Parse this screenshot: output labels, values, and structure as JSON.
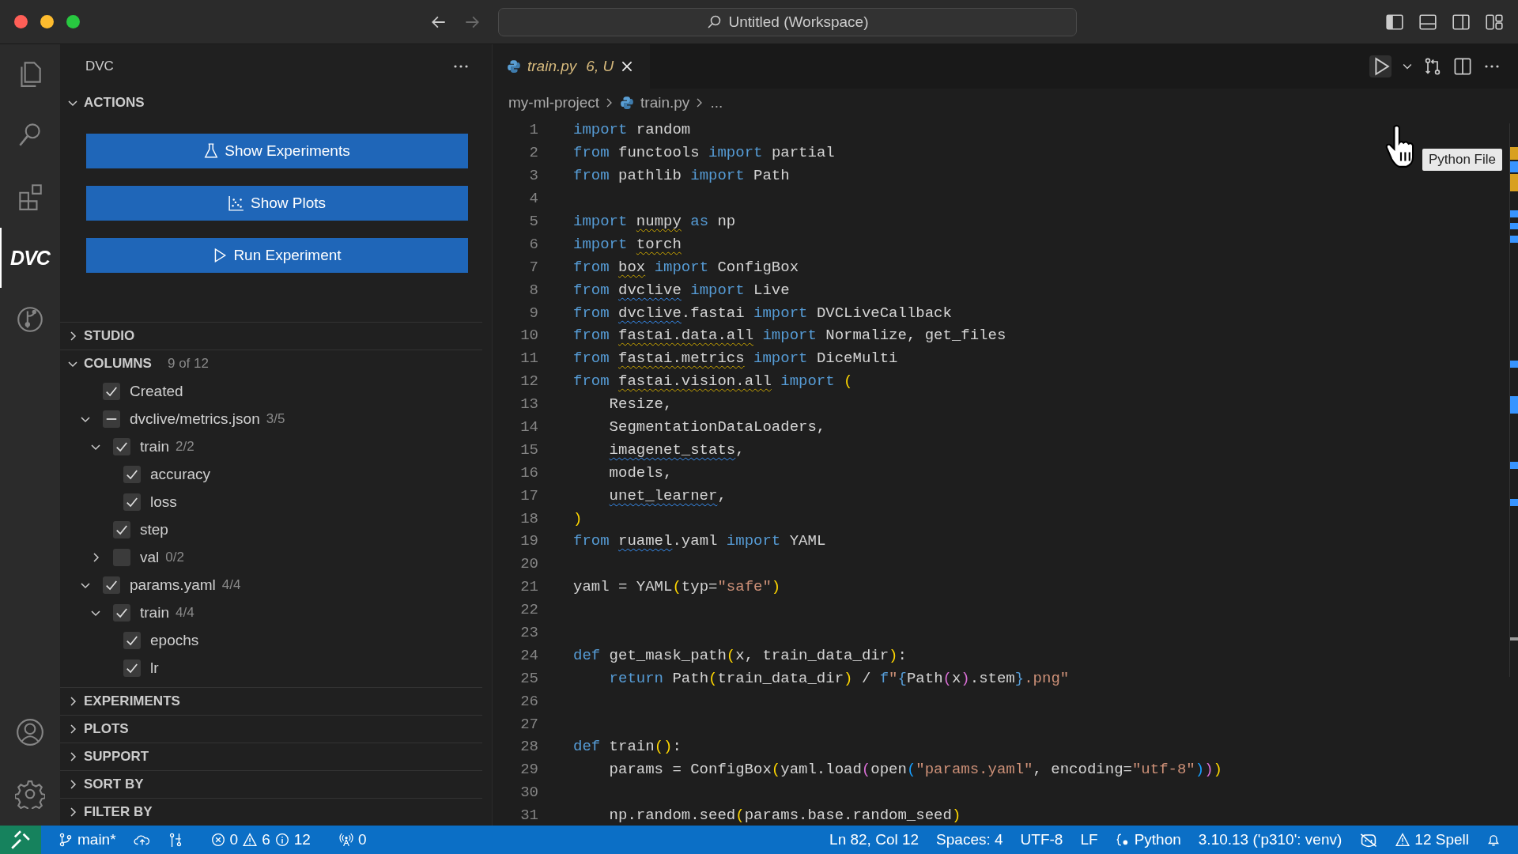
{
  "window": {
    "title": "Untitled (Workspace)",
    "nav": [
      {
        "kind": "back",
        "disabled": false
      },
      {
        "kind": "forward",
        "disabled": true
      }
    ]
  },
  "activity_bar": {
    "items": [
      {
        "kind": "files",
        "selected": false
      },
      {
        "kind": "search",
        "selected": false
      },
      {
        "kind": "extensions",
        "selected": false
      },
      {
        "kind": "dvc",
        "label": "DVC",
        "selected": true
      },
      {
        "kind": "graph",
        "selected": false
      }
    ],
    "bottom": [
      {
        "kind": "account"
      },
      {
        "kind": "settings"
      }
    ]
  },
  "sidebar": {
    "title": "DVC",
    "sections": [
      {
        "kind": "actions",
        "title": "ACTIONS",
        "expanded": true,
        "buttons": [
          {
            "kind": "flask",
            "label": "Show Experiments"
          },
          {
            "kind": "plot",
            "label": "Show Plots"
          },
          {
            "kind": "play",
            "label": "Run Experiment"
          }
        ]
      },
      {
        "kind": "plain",
        "title": "STUDIO",
        "expanded": false
      },
      {
        "kind": "tree",
        "title": "COLUMNS",
        "count": "9 of 12",
        "expanded": true,
        "items": [
          {
            "label": "Created",
            "checked": true
          },
          {
            "label": "dvclive/metrics.json",
            "count": "3/5",
            "mixed": true,
            "expanded": true,
            "children": [
              {
                "label": "train",
                "count": "2/2",
                "checked": true,
                "expanded": true,
                "children": [
                  {
                    "label": "accuracy",
                    "checked": true
                  },
                  {
                    "label": "loss",
                    "checked": true
                  }
                ]
              },
              {
                "label": "step",
                "checked": true
              },
              {
                "label": "val",
                "count": "0/2",
                "checked": false,
                "expanded": false
              }
            ]
          },
          {
            "label": "params.yaml",
            "count": "4/4",
            "checked": true,
            "expanded": true,
            "children": [
              {
                "label": "train",
                "count": "4/4",
                "checked": true,
                "expanded": true,
                "children": [
                  {
                    "label": "epochs",
                    "checked": true
                  },
                  {
                    "label": "lr",
                    "checked": true
                  }
                ]
              }
            ]
          }
        ]
      },
      {
        "kind": "plain",
        "title": "EXPERIMENTS",
        "expanded": false
      },
      {
        "kind": "plain",
        "title": "PLOTS",
        "expanded": false
      },
      {
        "kind": "plain",
        "title": "SUPPORT",
        "expanded": false
      },
      {
        "kind": "plain",
        "title": "SORT BY",
        "expanded": false
      },
      {
        "kind": "plain",
        "title": "FILTER BY",
        "expanded": false
      }
    ]
  },
  "editor": {
    "tabs": [
      {
        "name": "train.py",
        "status": "6, U",
        "selected": true
      }
    ],
    "breadcrumb": [
      "my-ml-project",
      "train.py",
      "..."
    ],
    "tooltip": "Python File",
    "lines": [
      {
        "number": "1",
        "tokens": [
          {
            "text": "import ",
            "kind": "keyword"
          },
          {
            "text": "random",
            "kind": "text"
          }
        ]
      },
      {
        "number": "2",
        "tokens": [
          {
            "text": "from ",
            "kind": "keyword"
          },
          {
            "text": "functools ",
            "kind": "text"
          },
          {
            "text": "import ",
            "kind": "keyword"
          },
          {
            "text": "partial",
            "kind": "text"
          }
        ]
      },
      {
        "number": "3",
        "tokens": [
          {
            "text": "from ",
            "kind": "keyword"
          },
          {
            "text": "pathlib ",
            "kind": "text"
          },
          {
            "text": "import ",
            "kind": "keyword"
          },
          {
            "text": "Path",
            "kind": "text"
          }
        ]
      },
      {
        "number": "4"
      },
      {
        "number": "5",
        "tokens": [
          {
            "text": "import ",
            "kind": "keyword"
          },
          {
            "text": "numpy",
            "kind": "warning"
          },
          {
            "text": " as ",
            "kind": "keyword"
          },
          {
            "text": "np",
            "kind": "text"
          }
        ]
      },
      {
        "number": "6",
        "tokens": [
          {
            "text": "import ",
            "kind": "keyword"
          },
          {
            "text": "torch",
            "kind": "warning"
          }
        ]
      },
      {
        "number": "7",
        "tokens": [
          {
            "text": "from ",
            "kind": "keyword"
          },
          {
            "text": "box",
            "kind": "warning"
          },
          {
            "text": " import ",
            "kind": "keyword"
          },
          {
            "text": "ConfigBox",
            "kind": "text"
          }
        ]
      },
      {
        "number": "8",
        "tokens": [
          {
            "text": "from ",
            "kind": "keyword"
          },
          {
            "text": "dvclive",
            "kind": "info"
          },
          {
            "text": " import ",
            "kind": "keyword"
          },
          {
            "text": "Live",
            "kind": "text"
          }
        ]
      },
      {
        "number": "9",
        "tokens": [
          {
            "text": "from ",
            "kind": "keyword"
          },
          {
            "text": "dvclive",
            "kind": "info"
          },
          {
            "text": ".fastai ",
            "kind": "text"
          },
          {
            "text": "import ",
            "kind": "keyword"
          },
          {
            "text": "DVCLiveCallback",
            "kind": "text"
          }
        ]
      },
      {
        "number": "10",
        "tokens": [
          {
            "text": "from ",
            "kind": "keyword"
          },
          {
            "text": "fastai.data.all",
            "kind": "warning"
          },
          {
            "text": " import ",
            "kind": "keyword"
          },
          {
            "text": "Normalize, get_files",
            "kind": "text"
          }
        ]
      },
      {
        "number": "11",
        "tokens": [
          {
            "text": "from ",
            "kind": "keyword"
          },
          {
            "text": "fastai.metrics",
            "kind": "warning"
          },
          {
            "text": " import ",
            "kind": "keyword"
          },
          {
            "text": "DiceMulti",
            "kind": "text"
          }
        ]
      },
      {
        "number": "12",
        "tokens": [
          {
            "text": "from ",
            "kind": "keyword"
          },
          {
            "text": "fastai.vision.all",
            "kind": "warning"
          },
          {
            "text": " import ",
            "kind": "keyword"
          },
          {
            "text": "(",
            "kind": "bracket1"
          }
        ]
      },
      {
        "number": "13",
        "indent": true,
        "tokens": [
          {
            "text": "Resize,",
            "kind": "text"
          }
        ]
      },
      {
        "number": "14",
        "indent": true,
        "tokens": [
          {
            "text": "SegmentationDataLoaders,",
            "kind": "text"
          }
        ]
      },
      {
        "number": "15",
        "indent": true,
        "tokens": [
          {
            "text": "imagenet_stats",
            "kind": "info"
          },
          {
            "text": ",",
            "kind": "text"
          }
        ]
      },
      {
        "number": "16",
        "indent": true,
        "tokens": [
          {
            "text": "models,",
            "kind": "text"
          }
        ]
      },
      {
        "number": "17",
        "indent": true,
        "tokens": [
          {
            "text": "unet_learner",
            "kind": "info"
          },
          {
            "text": ",",
            "kind": "text"
          }
        ]
      },
      {
        "number": "18",
        "tokens": [
          {
            "text": ")",
            "kind": "bracket1"
          }
        ]
      },
      {
        "number": "19",
        "tokens": [
          {
            "text": "from ",
            "kind": "keyword"
          },
          {
            "text": "ruamel",
            "kind": "info"
          },
          {
            "text": ".yaml ",
            "kind": "text"
          },
          {
            "text": "import ",
            "kind": "keyword"
          },
          {
            "text": "YAML",
            "kind": "text"
          }
        ]
      },
      {
        "number": "20"
      },
      {
        "number": "21",
        "tokens": [
          {
            "text": "yaml = YAML",
            "kind": "text"
          },
          {
            "text": "(",
            "kind": "bracket1"
          },
          {
            "text": "typ=",
            "kind": "text"
          },
          {
            "text": "\"safe\"",
            "kind": "string"
          },
          {
            "text": ")",
            "kind": "bracket1"
          }
        ]
      },
      {
        "number": "22"
      },
      {
        "number": "23"
      },
      {
        "number": "24",
        "tokens": [
          {
            "text": "def ",
            "kind": "keyword"
          },
          {
            "text": "get_mask_path",
            "kind": "text"
          },
          {
            "text": "(",
            "kind": "bracket1"
          },
          {
            "text": "x, train_data_dir",
            "kind": "text"
          },
          {
            "text": ")",
            "kind": "bracket1"
          },
          {
            "text": ":",
            "kind": "text"
          }
        ]
      },
      {
        "number": "25",
        "indent": true,
        "tokens": [
          {
            "text": "return ",
            "kind": "keyword"
          },
          {
            "text": "Path",
            "kind": "text"
          },
          {
            "text": "(",
            "kind": "bracket1"
          },
          {
            "text": "train_data_dir",
            "kind": "text"
          },
          {
            "text": ")",
            "kind": "bracket1"
          },
          {
            "text": " / ",
            "kind": "text"
          },
          {
            "text": "f",
            "kind": "keyword"
          },
          {
            "text": "\"",
            "kind": "string"
          },
          {
            "text": "{",
            "kind": "keyword"
          },
          {
            "text": "Path",
            "kind": "text"
          },
          {
            "text": "(",
            "kind": "bracket2"
          },
          {
            "text": "x",
            "kind": "text"
          },
          {
            "text": ")",
            "kind": "bracket2"
          },
          {
            "text": ".stem",
            "kind": "text"
          },
          {
            "text": "}",
            "kind": "keyword"
          },
          {
            "text": ".png\"",
            "kind": "string"
          }
        ]
      },
      {
        "number": "26"
      },
      {
        "number": "27"
      },
      {
        "number": "28",
        "tokens": [
          {
            "text": "def ",
            "kind": "keyword"
          },
          {
            "text": "train",
            "kind": "text"
          },
          {
            "text": "(",
            "kind": "bracket1"
          },
          {
            "text": ")",
            "kind": "bracket1"
          },
          {
            "text": ":",
            "kind": "text"
          }
        ]
      },
      {
        "number": "29",
        "indent": true,
        "tokens": [
          {
            "text": "params = ConfigBox",
            "kind": "text"
          },
          {
            "text": "(",
            "kind": "bracket1"
          },
          {
            "text": "yaml.load",
            "kind": "text"
          },
          {
            "text": "(",
            "kind": "bracket2"
          },
          {
            "text": "open",
            "kind": "text"
          },
          {
            "text": "(",
            "kind": "bracket3"
          },
          {
            "text": "\"params.yaml\"",
            "kind": "string"
          },
          {
            "text": ", encoding=",
            "kind": "text"
          },
          {
            "text": "\"utf-8\"",
            "kind": "string"
          },
          {
            "text": ")",
            "kind": "bracket3"
          },
          {
            "text": ")",
            "kind": "bracket2"
          },
          {
            "text": ")",
            "kind": "bracket1"
          }
        ]
      },
      {
        "number": "30"
      },
      {
        "number": "31",
        "indent": true,
        "tokens": [
          {
            "text": "np.random.seed",
            "kind": "text"
          },
          {
            "text": "(",
            "kind": "bracket1"
          },
          {
            "text": "params.base.random_seed",
            "kind": "text"
          },
          {
            "text": ")",
            "kind": "bracket1"
          }
        ]
      }
    ]
  },
  "status_bar": {
    "branch": "main*",
    "errors": "0",
    "warnings": "6",
    "infos": "12",
    "ports": "0",
    "position": "Ln 82, Col 12",
    "indent": "Spaces: 4",
    "encoding": "UTF-8",
    "eol": "LF",
    "language": "Python",
    "interpreter": "3.10.13 ('p310': venv)",
    "spell": "12 Spell"
  }
}
